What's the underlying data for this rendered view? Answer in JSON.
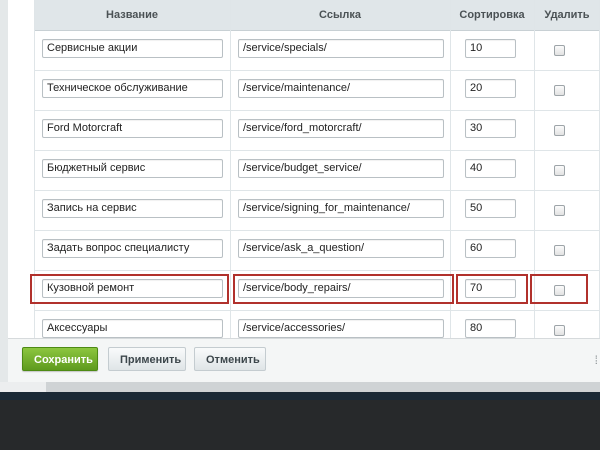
{
  "columns": {
    "name": "Название",
    "link": "Ссылка",
    "sort": "Сортировка",
    "delete": "Удалить"
  },
  "rows": [
    {
      "name": "Сервисные акции",
      "link": "/service/specials/",
      "sort": "10",
      "delete": false
    },
    {
      "name": "Техническое обслуживание",
      "link": "/service/maintenance/",
      "sort": "20",
      "delete": false
    },
    {
      "name": "Ford Motorcraft",
      "link": "/service/ford_motorcraft/",
      "sort": "30",
      "delete": false
    },
    {
      "name": "Бюджетный сервис",
      "link": "/service/budget_service/",
      "sort": "40",
      "delete": false
    },
    {
      "name": "Запись на сервис",
      "link": "/service/signing_for_maintenance/",
      "sort": "50",
      "delete": false
    },
    {
      "name": "Задать вопрос специалисту",
      "link": "/service/ask_a_question/",
      "sort": "60",
      "delete": false
    },
    {
      "name": "Кузовной ремонт",
      "link": "/service/body_repairs/",
      "sort": "70",
      "delete": false,
      "highlighted": true
    },
    {
      "name": "Аксессуары",
      "link": "/service/accessories/",
      "sort": "80",
      "delete": false
    }
  ],
  "buttons": {
    "save": "Сохранить",
    "apply": "Применить",
    "cancel": "Отменить"
  },
  "colors": {
    "highlight": "#b1312c",
    "save_button": "#6aaa28",
    "header_bg": "#e0e6e9"
  },
  "icons": {
    "resize": "dots-icon"
  }
}
